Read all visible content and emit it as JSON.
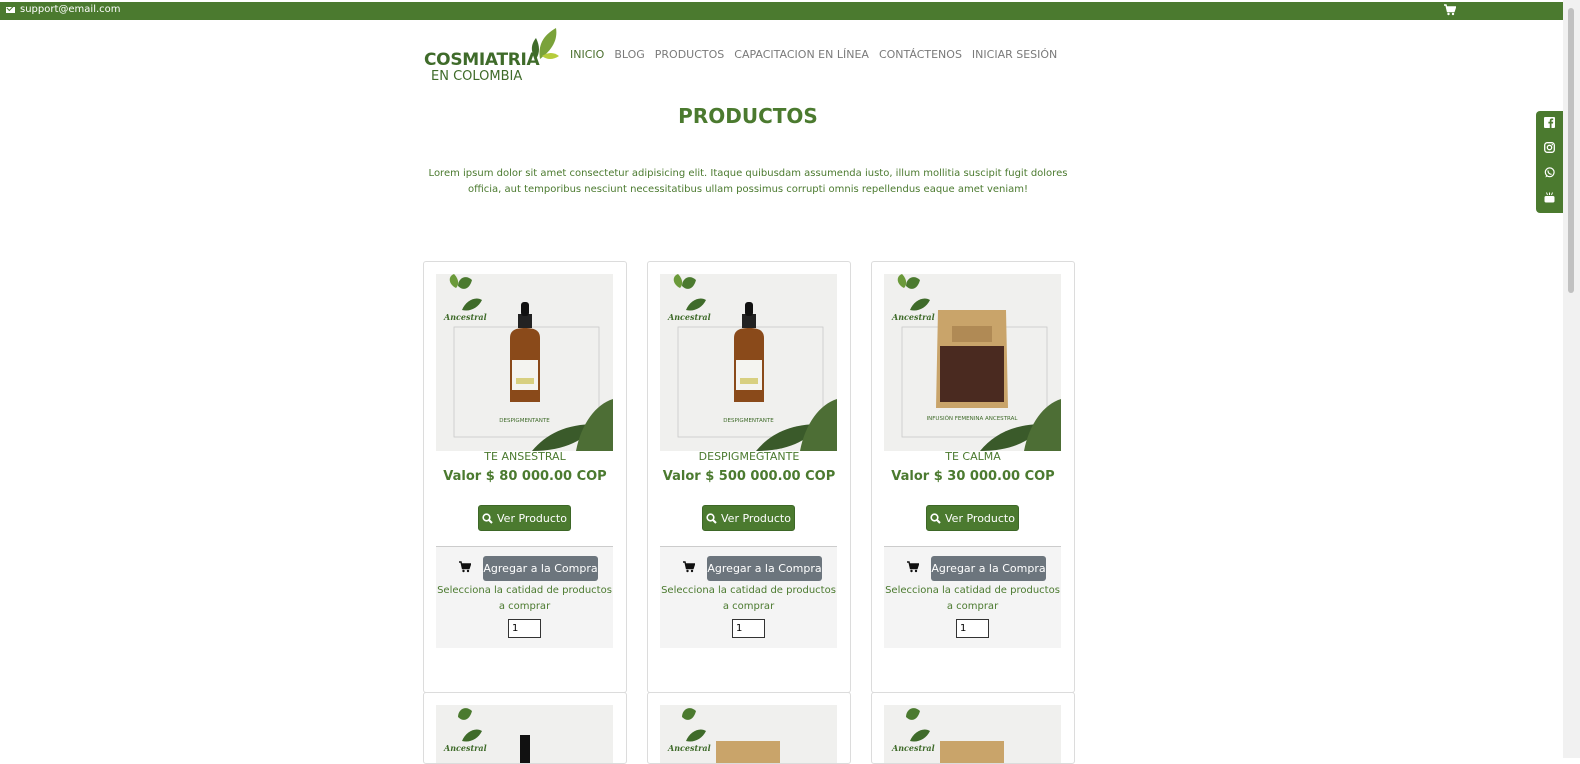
{
  "topbar": {
    "email": "support@email.com",
    "cart_icon": "cart-icon"
  },
  "brand": {
    "line1": "COSMIATRIA",
    "line2": "EN COLOMBIA"
  },
  "nav": [
    "INICIO",
    "BLOG",
    "PRODUCTOS",
    "CAPACITACION EN LÍNEA",
    "CONTÁCTENOS",
    "INICIAR SESIÓN"
  ],
  "page": {
    "title": "PRODUCTOS",
    "intro": "Lorem ipsum dolor sit amet consectetur adipisicing elit. Itaque quibusdam assumenda iusto, illum mollitia suscipit fugit dolores officia, aut temporibus nesciunt necessitatibus ullam possimus corrupti omnis repellendus eaque amet veniam!"
  },
  "social": [
    "facebook-icon",
    "instagram-icon",
    "whatsapp-icon",
    "youtube-icon"
  ],
  "products": [
    {
      "name": "TE ANSESTRAL",
      "price": "Valor $ 80 000.00 COP",
      "view_label": "Ver Producto",
      "add_label": "Agregar a la Compra",
      "hint": "Selecciona la catidad de productos a comprar",
      "qty": "1",
      "image_brand": "Ancestral",
      "image_caption": "DESPIGMENTANTE",
      "image_kind": "bottle"
    },
    {
      "name": "DESPIGMEGTANTE",
      "price": "Valor $ 500 000.00 COP",
      "view_label": "Ver Producto",
      "add_label": "Agregar a la Compra",
      "hint": "Selecciona la catidad de productos a comprar",
      "qty": "1",
      "image_brand": "Ancestral",
      "image_caption": "DESPIGMENTANTE",
      "image_kind": "bottle"
    },
    {
      "name": "TE CALMA",
      "price": "Valor $ 30 000.00 COP",
      "view_label": "Ver Producto",
      "add_label": "Agregar a la Compra",
      "hint": "Selecciona la catidad de productos a comprar",
      "qty": "1",
      "image_brand": "Ancestral",
      "image_caption": "INFUSIÓN FEMENINA ANCESTRAL",
      "image_kind": "pouch"
    }
  ],
  "next_row_brand": "Ancestral"
}
